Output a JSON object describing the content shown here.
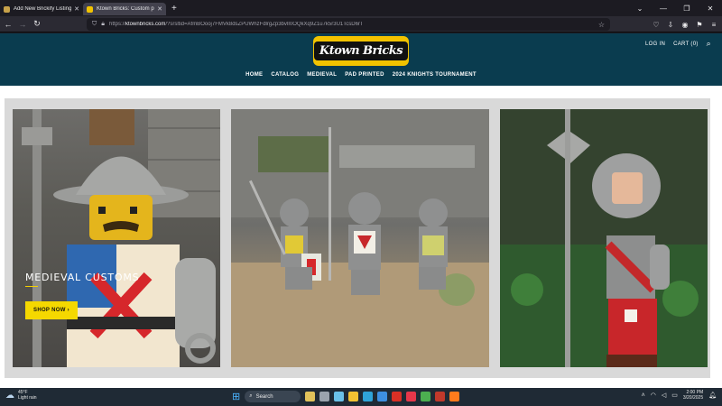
{
  "browser": {
    "tabs": [
      {
        "title": "Add New Brickify Listing",
        "active": false,
        "favicon_color": "#c8a24a"
      },
      {
        "title": "Ktown Bricks: Custom printed L",
        "active": true,
        "favicon_color": "#f2c300"
      }
    ],
    "url_prefix": "https://",
    "url_domain": "ktownbricks.com",
    "url_rest": "/?srsltid=AfmBOooj7FMVk8dsZPUWhzFdlrgZp3bvlI0OQkXq9Z1u7k5r3U1TcsD6rT",
    "icons": [
      "back-icon",
      "forward-icon",
      "reload-icon",
      "shield-icon",
      "lock-icon",
      "star-icon",
      "pocket-icon",
      "account-icon",
      "extensions-icon",
      "menu-icon"
    ]
  },
  "site": {
    "logo_text": "Ktown Bricks",
    "header_links": {
      "login": "LOG IN",
      "cart": "CART (0)"
    },
    "nav": [
      "HOME",
      "CATALOG",
      "MEDIEVAL",
      "PAD PRINTED",
      "2024 KNIGHTS TOURNAMENT"
    ],
    "hero": {
      "title": "MEDIEVAL CUSTOMS",
      "button": "SHOP NOW"
    },
    "colors": {
      "header_bg": "#0a3c4f",
      "accent": "#f5d800"
    }
  },
  "taskbar": {
    "weather_temp": "45°F",
    "weather_desc": "Light rain",
    "search_label": "Search",
    "time": "2:00 PM",
    "date": "3/20/2025"
  }
}
